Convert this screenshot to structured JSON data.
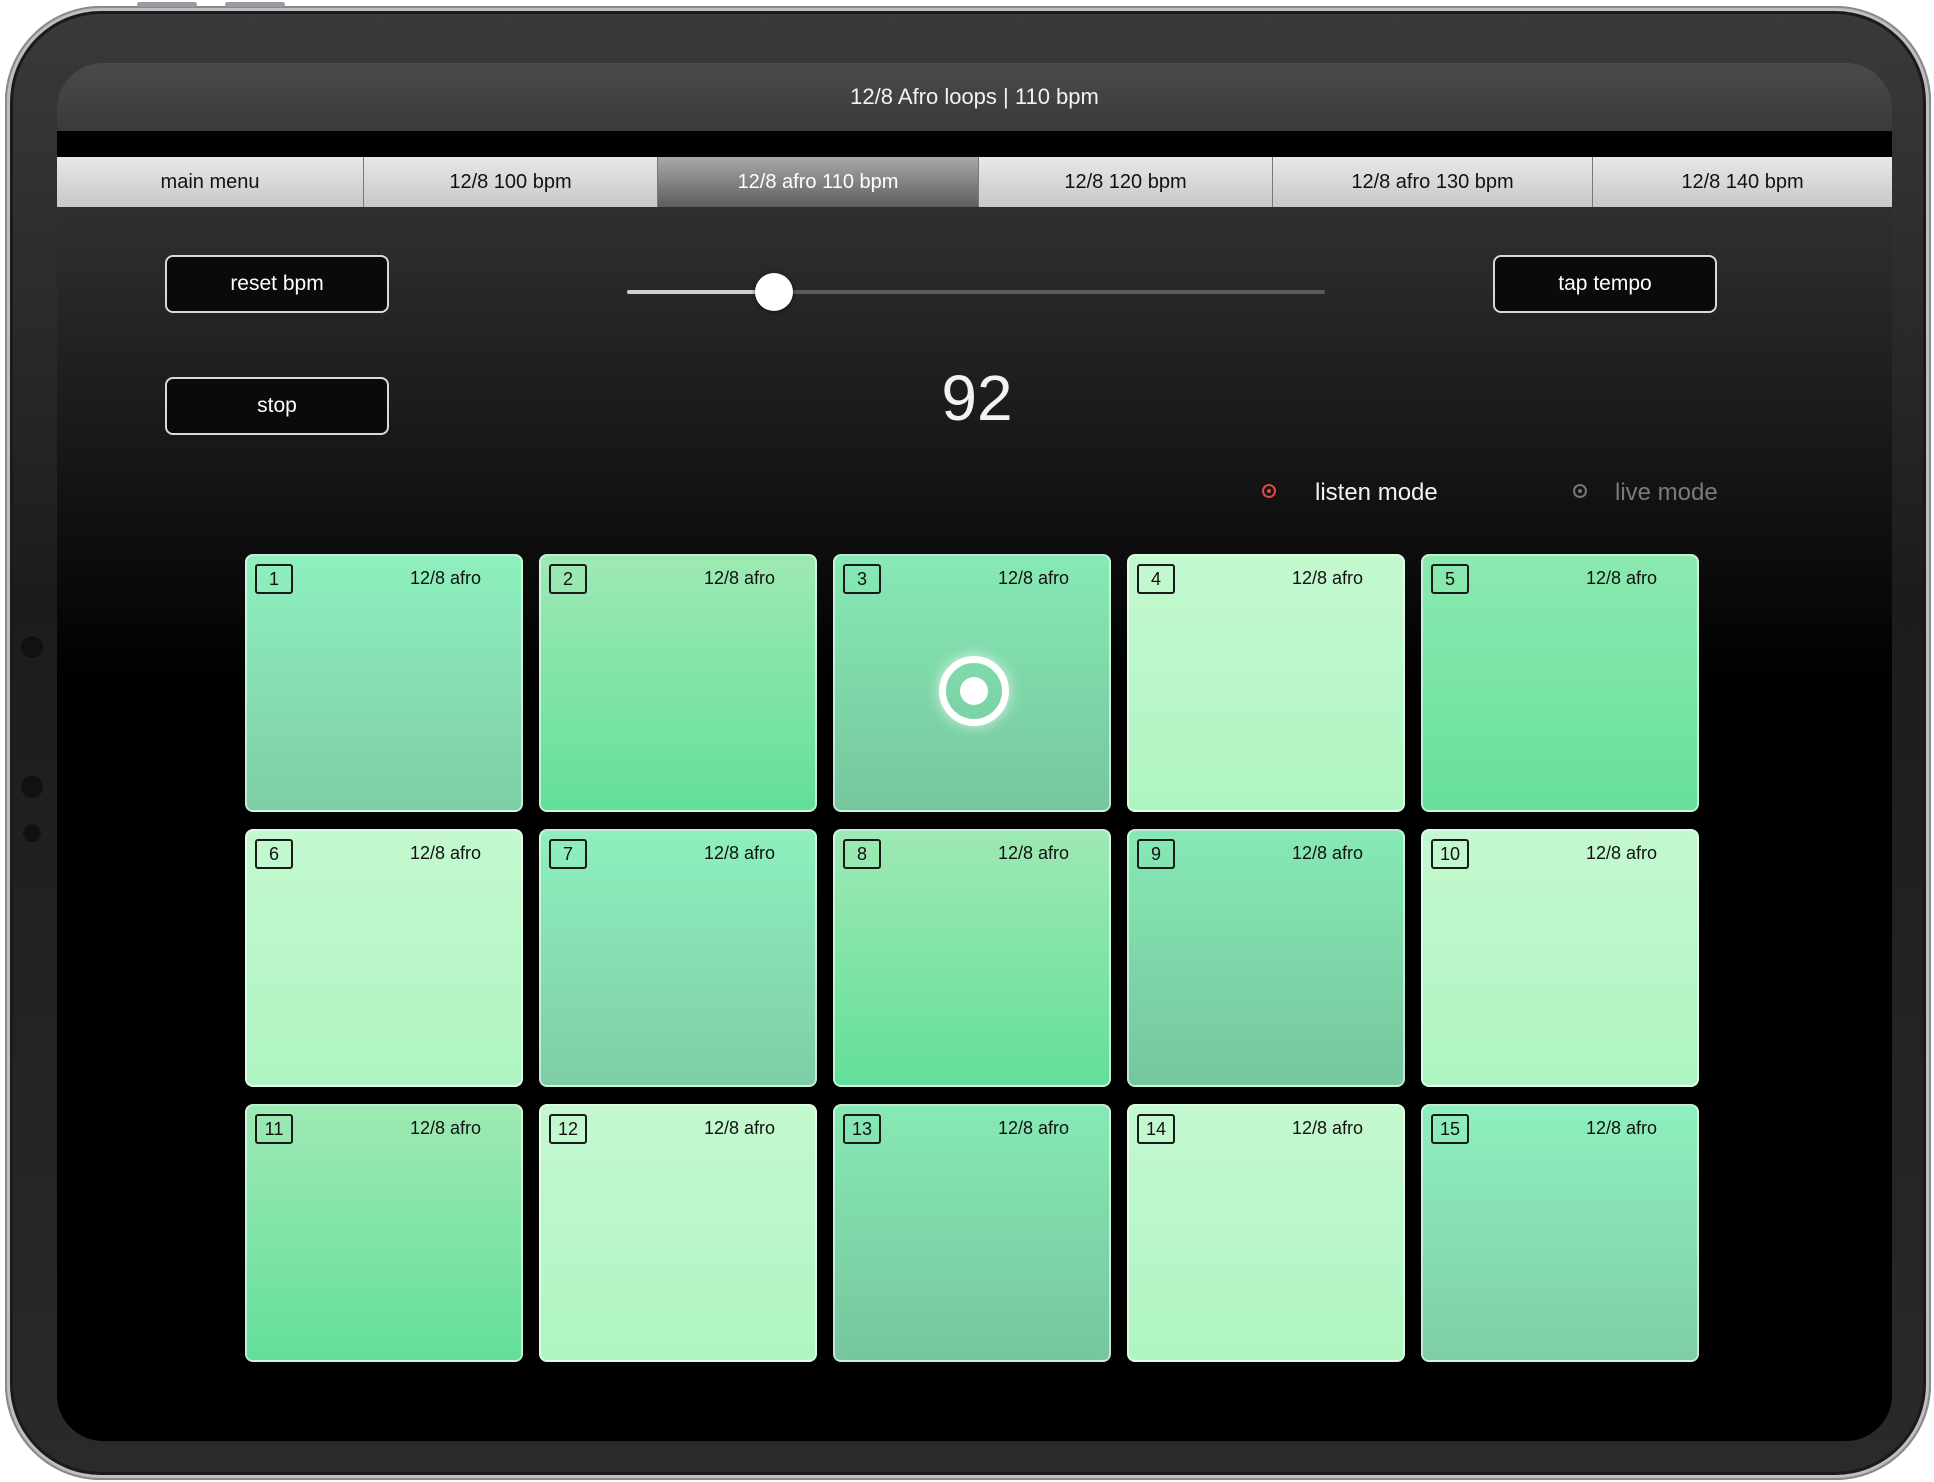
{
  "titlebar": {
    "title": "12/8 Afro loops  |  110 bpm"
  },
  "tabs": [
    {
      "label": "main menu",
      "active": false
    },
    {
      "label": "12/8 100 bpm",
      "active": false
    },
    {
      "label": "12/8 afro 110 bpm",
      "active": true
    },
    {
      "label": "12/8 120 bpm",
      "active": false
    },
    {
      "label": "12/8 afro 130 bpm",
      "active": false
    },
    {
      "label": "12/8 140 bpm",
      "active": false
    }
  ],
  "controls": {
    "reset_label": "reset bpm",
    "stop_label": "stop",
    "tap_label": "tap tempo",
    "bpm_value": "92",
    "slider_fraction": 0.21
  },
  "modes": {
    "listen_label": "listen mode",
    "live_label": "live mode",
    "selected": "listen",
    "selected_color": "#e04848"
  },
  "pads": [
    {
      "number": "1",
      "label": "12/8 afro",
      "style": "a"
    },
    {
      "number": "2",
      "label": "12/8 afro",
      "style": "b"
    },
    {
      "number": "3",
      "label": "12/8 afro",
      "style": "c",
      "playing": true
    },
    {
      "number": "4",
      "label": "12/8 afro",
      "style": "d"
    },
    {
      "number": "5",
      "label": "12/8 afro",
      "style": "e"
    },
    {
      "number": "6",
      "label": "12/8 afro",
      "style": "d"
    },
    {
      "number": "7",
      "label": "12/8 afro",
      "style": "a"
    },
    {
      "number": "8",
      "label": "12/8 afro",
      "style": "b"
    },
    {
      "number": "9",
      "label": "12/8 afro",
      "style": "c"
    },
    {
      "number": "10",
      "label": "12/8 afro",
      "style": "d"
    },
    {
      "number": "11",
      "label": "12/8 afro",
      "style": "b"
    },
    {
      "number": "12",
      "label": "12/8 afro",
      "style": "d"
    },
    {
      "number": "13",
      "label": "12/8 afro",
      "style": "c"
    },
    {
      "number": "14",
      "label": "12/8 afro",
      "style": "d"
    },
    {
      "number": "15",
      "label": "12/8 afro",
      "style": "a"
    }
  ]
}
